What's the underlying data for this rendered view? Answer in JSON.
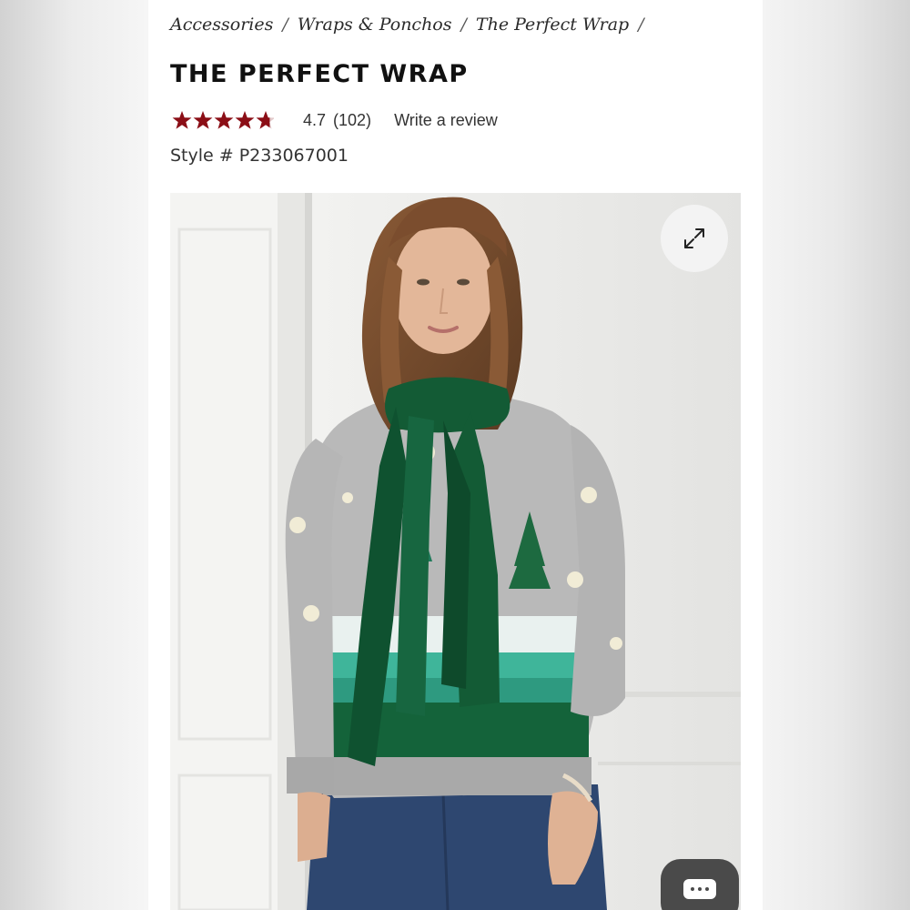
{
  "breadcrumb": {
    "items": [
      "Accessories",
      "Wraps & Ponchos",
      "The Perfect Wrap"
    ],
    "separator": "/"
  },
  "product": {
    "title": "THE PERFECT WRAP",
    "rating_value": "4.7",
    "rating_count": "(102)",
    "rating_stars": 4.7,
    "write_review": "Write a review",
    "style_number": "Style # P233067001"
  },
  "colors": {
    "star": "#8b0e16",
    "wrap_green": "#135b35"
  },
  "icons": {
    "expand": "expand-arrows-icon",
    "chat": "chat-icon"
  }
}
